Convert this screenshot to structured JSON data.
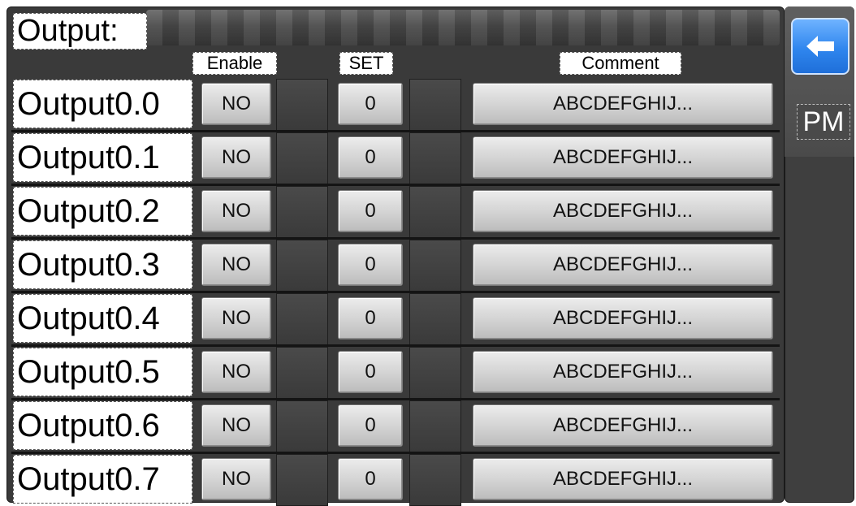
{
  "title": "Output:",
  "columns": {
    "enable": "Enable",
    "set": "SET",
    "comment": "Comment"
  },
  "rows": [
    {
      "label": "Output0.0",
      "enable": "NO",
      "set": "0",
      "comment": "ABCDEFGHIJ..."
    },
    {
      "label": "Output0.1",
      "enable": "NO",
      "set": "0",
      "comment": "ABCDEFGHIJ..."
    },
    {
      "label": "Output0.2",
      "enable": "NO",
      "set": "0",
      "comment": "ABCDEFGHIJ..."
    },
    {
      "label": "Output0.3",
      "enable": "NO",
      "set": "0",
      "comment": "ABCDEFGHIJ..."
    },
    {
      "label": "Output0.4",
      "enable": "NO",
      "set": "0",
      "comment": "ABCDEFGHIJ..."
    },
    {
      "label": "Output0.5",
      "enable": "NO",
      "set": "0",
      "comment": "ABCDEFGHIJ..."
    },
    {
      "label": "Output0.6",
      "enable": "NO",
      "set": "0",
      "comment": "ABCDEFGHIJ..."
    },
    {
      "label": "Output0.7",
      "enable": "NO",
      "set": "0",
      "comment": "ABCDEFGHIJ..."
    }
  ],
  "side": {
    "back_icon": "arrow-left-icon",
    "pm_label": "PM"
  },
  "colors": {
    "panel": "#3a3a3a",
    "accent_blue": "#2f86ee",
    "button_face": "#d2d2d2"
  }
}
